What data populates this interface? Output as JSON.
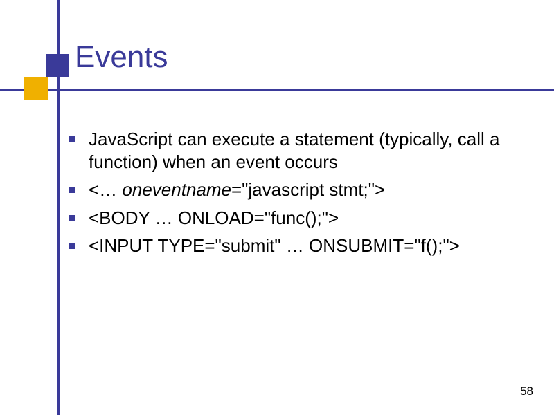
{
  "title": "Events",
  "bullets": [
    {
      "text": "JavaScript can execute a statement (typically, call a function) when an event occurs"
    },
    {
      "prefix": "<… ",
      "italic": "oneventname",
      "suffix": "=\"javascript stmt;\">"
    },
    {
      "text": "<BODY … ONLOAD=\"func();\">"
    },
    {
      "text": "<INPUT TYPE=\"submit\" … ONSUBMIT=\"f();\">"
    }
  ],
  "page_number": "58"
}
